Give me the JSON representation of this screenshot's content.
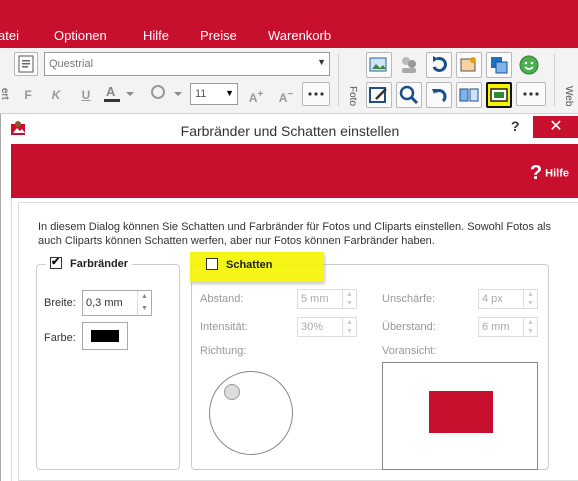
{
  "menu": {
    "items": [
      "atei",
      "Optionen",
      "Hilfe",
      "Preise",
      "Warenkorb"
    ]
  },
  "toolbar": {
    "font_family": "Questrial",
    "font_size": "11",
    "format_buttons": [
      "F",
      "K",
      "U"
    ],
    "vertical_labels": [
      "ert",
      "Foto",
      "Web"
    ]
  },
  "dialog": {
    "title": "Farbränder und Schatten einstellen",
    "help_q": "?",
    "close": "✕",
    "help_label": "Hilfe",
    "help_mark": "?",
    "description": "In diesem Dialog können Sie Schatten und Farbränder für Fotos und Cliparts einstellen. Sowohl Fotos als auch Cliparts können Schatten werfen, aber nur Fotos können Farbränder haben.",
    "border_group": {
      "title": "Farbränder",
      "checked": true,
      "width_label": "Breite:",
      "width_value": "0,3 mm",
      "color_label": "Farbe:",
      "color": "#000000"
    },
    "shadow_group": {
      "title": "Schatten",
      "checked": false,
      "distance_label": "Abstand:",
      "distance_value": "5 mm",
      "intensity_label": "Intensität:",
      "intensity_value": "30%",
      "direction_label": "Richtung:",
      "blur_label": "Unschärfe:",
      "blur_value": "4 px",
      "overhang_label": "Überstand:",
      "overhang_value": "6 mm",
      "preview_label": "Voransicht:"
    }
  },
  "colors": {
    "accent": "#c8102e",
    "highlight": "#f5f500"
  }
}
